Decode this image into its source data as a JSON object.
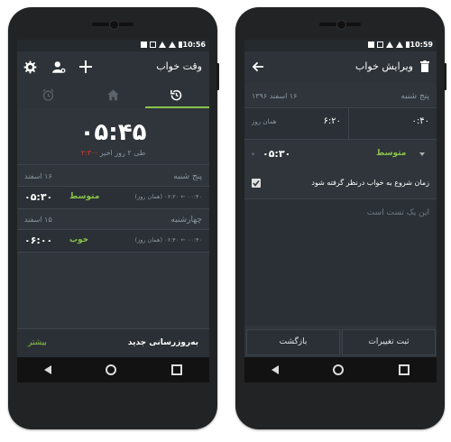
{
  "left": {
    "status_time": "10:56",
    "title": "وقت خواب",
    "big_time": "۰۵:۴۵",
    "sub_red": "-۲:۳۰",
    "sub_gray": "طی ۲ روز اخیر",
    "days": [
      {
        "day": "پنج شنبه",
        "date": "۱۶ اسفند",
        "duration": "۰۵:۳۰",
        "quality": "متوسط",
        "quality_color": "#8bc34a",
        "range": "۰۰:۴۰ ← ۰۶:۲۰ (همان روز)"
      },
      {
        "day": "چهارشنبه",
        "date": "۱۵ اسفند",
        "duration": "۰۶:۰۰",
        "quality": "خوب",
        "quality_color": "#8bc34a",
        "range": "۰۰:۴۰ ← ۰۶:۴۰ (همان روز)"
      }
    ],
    "bottom_left": "بیشتر",
    "bottom_right": "به‌روزرسانی جدید",
    "tabs": [
      "alarm-icon",
      "home-icon",
      "history-icon"
    ],
    "active_tab_color": "#8bc34a"
  },
  "right": {
    "status_time": "10:59",
    "title": "ویرایش خواب",
    "day": "پنج شنبه",
    "date": "۱۶ اسفند ۱۳۹۶",
    "start_time": "۰:۴۰",
    "end_time": "۶:۲۰",
    "same_day": "همان روز",
    "quality": "متوسط",
    "duration": "۰۵:۳۰",
    "duration_suffix": "ه",
    "checkbox_label": "زمان شروع به خواب درنظر گرفته شود",
    "note": "این یک تست است",
    "btn_back": "بازگشت",
    "btn_save": "ثبت تغییرات"
  }
}
